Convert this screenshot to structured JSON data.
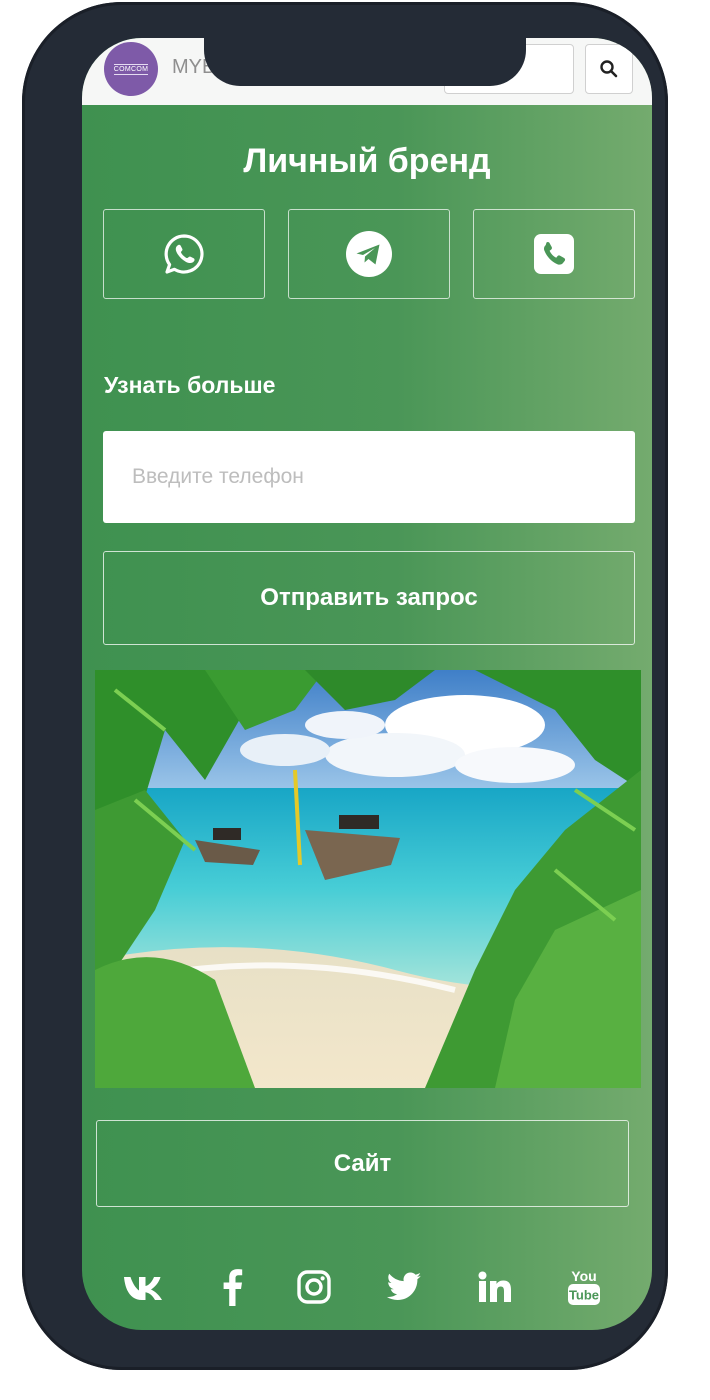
{
  "header": {
    "logo_text": "COMCOM",
    "brand_text": "MYB",
    "search_placeholder": "",
    "search_icon": "search-icon"
  },
  "main": {
    "title": "Личный бренд",
    "contacts": [
      {
        "name": "whatsapp",
        "icon": "whatsapp-icon"
      },
      {
        "name": "telegram",
        "icon": "telegram-icon"
      },
      {
        "name": "phone",
        "icon": "phone-icon"
      }
    ],
    "learn_more_label": "Узнать больше",
    "phone_placeholder": "Введите телефон",
    "submit_label": "Отправить запрос",
    "site_label": "Сайт"
  },
  "social": [
    {
      "name": "vk",
      "icon": "vk-icon"
    },
    {
      "name": "facebook",
      "icon": "facebook-icon"
    },
    {
      "name": "instagram",
      "icon": "instagram-icon"
    },
    {
      "name": "twitter",
      "icon": "twitter-icon"
    },
    {
      "name": "linkedin",
      "icon": "linkedin-icon"
    },
    {
      "name": "youtube",
      "icon": "youtube-icon",
      "text_top": "You",
      "text_bottom": "Tube"
    }
  ],
  "colors": {
    "gradient_start": "#3f9150",
    "gradient_end": "#74ab6e",
    "phone_frame": "#242b36",
    "logo_bg": "#7e5aa8"
  }
}
